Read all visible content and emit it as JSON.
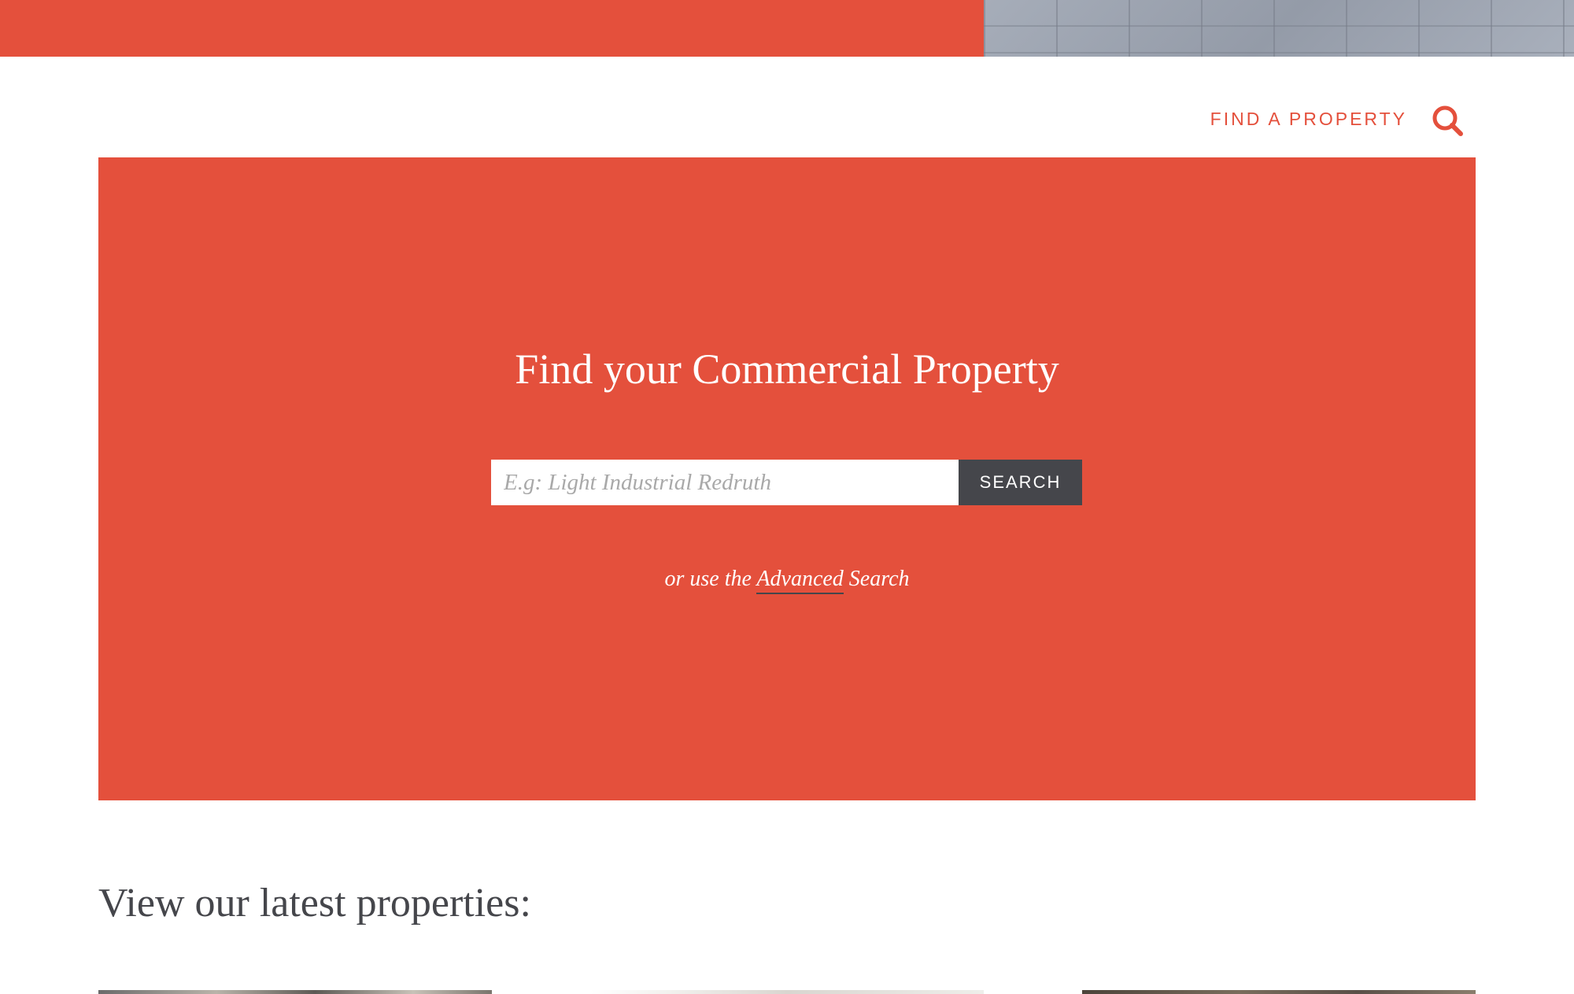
{
  "header": {
    "nav_link_label": "FIND A PROPERTY",
    "search_icon": "search-icon"
  },
  "hero": {
    "title": "Find your Commercial Property",
    "search_placeholder": "E.g: Light Industrial Redruth",
    "search_value": "",
    "search_button_label": "SEARCH",
    "advanced_prefix": "or use the",
    "advanced_link_label": "Advanced",
    "advanced_suffix": "Search"
  },
  "latest": {
    "heading": "View our latest properties:"
  },
  "colors": {
    "brand_red": "#e4503c",
    "dark_gray": "#45464b",
    "white": "#ffffff"
  }
}
